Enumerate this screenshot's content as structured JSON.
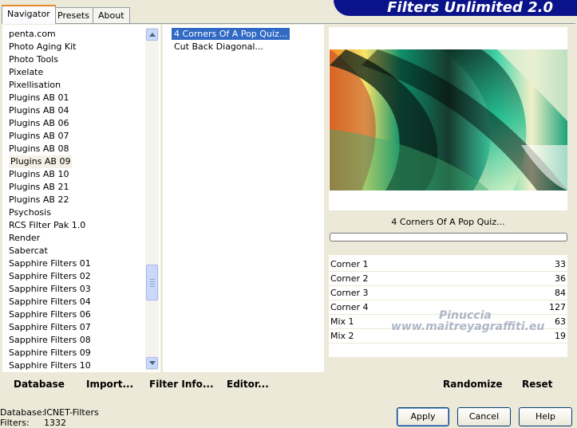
{
  "tabs": [
    {
      "label": "Navigator"
    },
    {
      "label": "Presets"
    },
    {
      "label": "About"
    }
  ],
  "banner_title": "Filters Unlimited 2.0",
  "category_list": [
    "penta.com",
    "Photo Aging Kit",
    "Photo Tools",
    "Pixelate",
    "Pixellisation",
    "Plugins AB 01",
    "Plugins AB 04",
    "Plugins AB 06",
    "Plugins AB 07",
    "Plugins AB 08",
    "Plugins AB 09",
    "Plugins AB 10",
    "Plugins AB 21",
    "Plugins AB 22",
    "Psychosis",
    "RCS Filter Pak 1.0",
    "Render",
    "Sabercat",
    "Sapphire Filters 01",
    "Sapphire Filters 02",
    "Sapphire Filters 03",
    "Sapphire Filters 04",
    "Sapphire Filters 06",
    "Sapphire Filters 07",
    "Sapphire Filters 08",
    "Sapphire Filters 09",
    "Sapphire Filters 10"
  ],
  "category_selected": "Plugins AB 09",
  "filter_list": [
    "4 Corners Of A Pop Quiz...",
    "Cut Back Diagonal..."
  ],
  "filter_selected": "4 Corners Of A Pop Quiz...",
  "current_filter_name": "4 Corners Of A Pop Quiz...",
  "params": [
    {
      "label": "Corner 1",
      "value": "33"
    },
    {
      "label": "Corner 2",
      "value": "36"
    },
    {
      "label": "Corner 3",
      "value": "84"
    },
    {
      "label": "Corner 4",
      "value": "127"
    },
    {
      "label": "Mix 1",
      "value": "63"
    },
    {
      "label": "Mix 2",
      "value": "19"
    }
  ],
  "watermark_line1": "Pinuccia",
  "watermark_line2": "www.maitreyagraffiti.eu",
  "bottom_links": {
    "database": "Database",
    "import": "Import...",
    "filter_info": "Filter Info...",
    "editor": "Editor...",
    "randomize": "Randomize",
    "reset": "Reset"
  },
  "buttons": {
    "apply": "Apply",
    "cancel": "Cancel",
    "help": "Help"
  },
  "status": {
    "database_label": "Database:",
    "database_value": "ICNET-Filters",
    "filters_label": "Filters:",
    "filters_value": "1332"
  },
  "icons": {
    "scroll_up": "arrow-up-icon",
    "scroll_down": "arrow-down-icon"
  }
}
